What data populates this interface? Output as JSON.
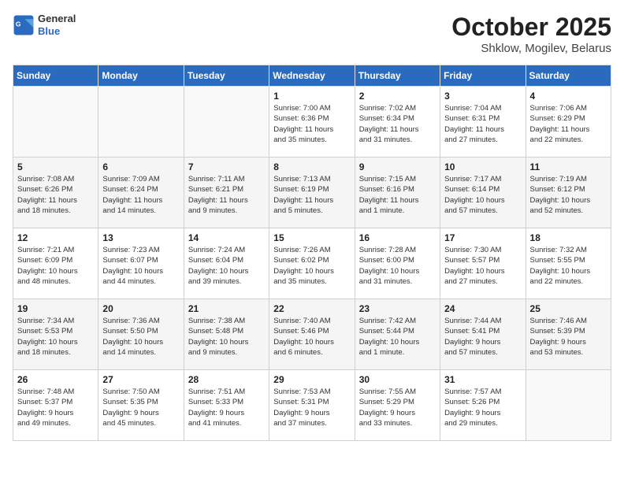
{
  "logo": {
    "line1": "General",
    "line2": "Blue"
  },
  "title": "October 2025",
  "subtitle": "Shklow, Mogilev, Belarus",
  "weekdays": [
    "Sunday",
    "Monday",
    "Tuesday",
    "Wednesday",
    "Thursday",
    "Friday",
    "Saturday"
  ],
  "weeks": [
    [
      {
        "day": "",
        "detail": ""
      },
      {
        "day": "",
        "detail": ""
      },
      {
        "day": "",
        "detail": ""
      },
      {
        "day": "1",
        "detail": "Sunrise: 7:00 AM\nSunset: 6:36 PM\nDaylight: 11 hours\nand 35 minutes."
      },
      {
        "day": "2",
        "detail": "Sunrise: 7:02 AM\nSunset: 6:34 PM\nDaylight: 11 hours\nand 31 minutes."
      },
      {
        "day": "3",
        "detail": "Sunrise: 7:04 AM\nSunset: 6:31 PM\nDaylight: 11 hours\nand 27 minutes."
      },
      {
        "day": "4",
        "detail": "Sunrise: 7:06 AM\nSunset: 6:29 PM\nDaylight: 11 hours\nand 22 minutes."
      }
    ],
    [
      {
        "day": "5",
        "detail": "Sunrise: 7:08 AM\nSunset: 6:26 PM\nDaylight: 11 hours\nand 18 minutes."
      },
      {
        "day": "6",
        "detail": "Sunrise: 7:09 AM\nSunset: 6:24 PM\nDaylight: 11 hours\nand 14 minutes."
      },
      {
        "day": "7",
        "detail": "Sunrise: 7:11 AM\nSunset: 6:21 PM\nDaylight: 11 hours\nand 9 minutes."
      },
      {
        "day": "8",
        "detail": "Sunrise: 7:13 AM\nSunset: 6:19 PM\nDaylight: 11 hours\nand 5 minutes."
      },
      {
        "day": "9",
        "detail": "Sunrise: 7:15 AM\nSunset: 6:16 PM\nDaylight: 11 hours\nand 1 minute."
      },
      {
        "day": "10",
        "detail": "Sunrise: 7:17 AM\nSunset: 6:14 PM\nDaylight: 10 hours\nand 57 minutes."
      },
      {
        "day": "11",
        "detail": "Sunrise: 7:19 AM\nSunset: 6:12 PM\nDaylight: 10 hours\nand 52 minutes."
      }
    ],
    [
      {
        "day": "12",
        "detail": "Sunrise: 7:21 AM\nSunset: 6:09 PM\nDaylight: 10 hours\nand 48 minutes."
      },
      {
        "day": "13",
        "detail": "Sunrise: 7:23 AM\nSunset: 6:07 PM\nDaylight: 10 hours\nand 44 minutes."
      },
      {
        "day": "14",
        "detail": "Sunrise: 7:24 AM\nSunset: 6:04 PM\nDaylight: 10 hours\nand 39 minutes."
      },
      {
        "day": "15",
        "detail": "Sunrise: 7:26 AM\nSunset: 6:02 PM\nDaylight: 10 hours\nand 35 minutes."
      },
      {
        "day": "16",
        "detail": "Sunrise: 7:28 AM\nSunset: 6:00 PM\nDaylight: 10 hours\nand 31 minutes."
      },
      {
        "day": "17",
        "detail": "Sunrise: 7:30 AM\nSunset: 5:57 PM\nDaylight: 10 hours\nand 27 minutes."
      },
      {
        "day": "18",
        "detail": "Sunrise: 7:32 AM\nSunset: 5:55 PM\nDaylight: 10 hours\nand 22 minutes."
      }
    ],
    [
      {
        "day": "19",
        "detail": "Sunrise: 7:34 AM\nSunset: 5:53 PM\nDaylight: 10 hours\nand 18 minutes."
      },
      {
        "day": "20",
        "detail": "Sunrise: 7:36 AM\nSunset: 5:50 PM\nDaylight: 10 hours\nand 14 minutes."
      },
      {
        "day": "21",
        "detail": "Sunrise: 7:38 AM\nSunset: 5:48 PM\nDaylight: 10 hours\nand 9 minutes."
      },
      {
        "day": "22",
        "detail": "Sunrise: 7:40 AM\nSunset: 5:46 PM\nDaylight: 10 hours\nand 6 minutes."
      },
      {
        "day": "23",
        "detail": "Sunrise: 7:42 AM\nSunset: 5:44 PM\nDaylight: 10 hours\nand 1 minute."
      },
      {
        "day": "24",
        "detail": "Sunrise: 7:44 AM\nSunset: 5:41 PM\nDaylight: 9 hours\nand 57 minutes."
      },
      {
        "day": "25",
        "detail": "Sunrise: 7:46 AM\nSunset: 5:39 PM\nDaylight: 9 hours\nand 53 minutes."
      }
    ],
    [
      {
        "day": "26",
        "detail": "Sunrise: 7:48 AM\nSunset: 5:37 PM\nDaylight: 9 hours\nand 49 minutes."
      },
      {
        "day": "27",
        "detail": "Sunrise: 7:50 AM\nSunset: 5:35 PM\nDaylight: 9 hours\nand 45 minutes."
      },
      {
        "day": "28",
        "detail": "Sunrise: 7:51 AM\nSunset: 5:33 PM\nDaylight: 9 hours\nand 41 minutes."
      },
      {
        "day": "29",
        "detail": "Sunrise: 7:53 AM\nSunset: 5:31 PM\nDaylight: 9 hours\nand 37 minutes."
      },
      {
        "day": "30",
        "detail": "Sunrise: 7:55 AM\nSunset: 5:29 PM\nDaylight: 9 hours\nand 33 minutes."
      },
      {
        "day": "31",
        "detail": "Sunrise: 7:57 AM\nSunset: 5:26 PM\nDaylight: 9 hours\nand 29 minutes."
      },
      {
        "day": "",
        "detail": ""
      }
    ]
  ]
}
